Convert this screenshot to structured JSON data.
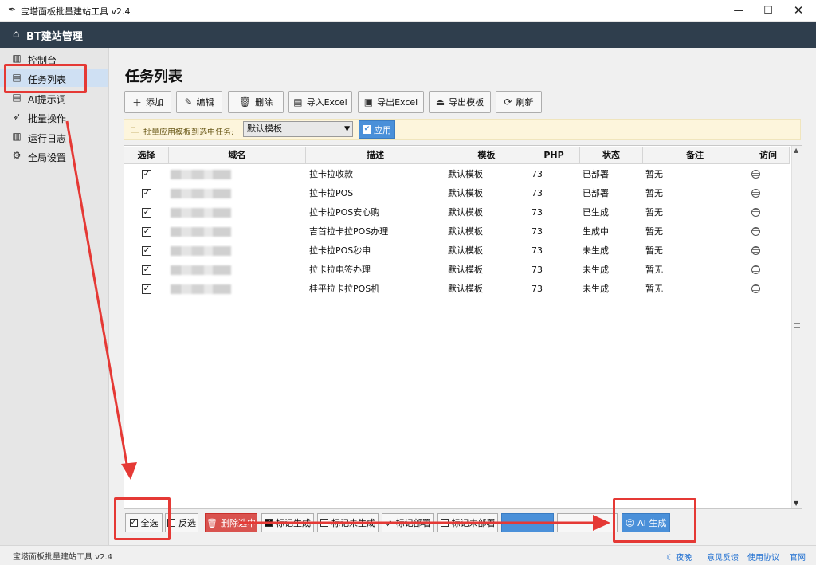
{
  "window": {
    "title": "宝塔面板批量建站工具 v2.4",
    "min": "—",
    "max": "☐",
    "close": "✕"
  },
  "header": {
    "brand": "BT建站管理"
  },
  "sidebar": {
    "items": [
      {
        "label": "控制台",
        "icon": "chart-icon",
        "glyph": "▥"
      },
      {
        "label": "任务列表",
        "icon": "clipboard-icon",
        "glyph": "▤"
      },
      {
        "label": "AI提示词",
        "icon": "document-icon",
        "glyph": "▤"
      },
      {
        "label": "批量操作",
        "icon": "rocket-icon",
        "glyph": "➶"
      },
      {
        "label": "运行日志",
        "icon": "book-icon",
        "glyph": "▥"
      },
      {
        "label": "全局设置",
        "icon": "gear-icon",
        "glyph": "⚙"
      }
    ]
  },
  "main": {
    "title": "任务列表",
    "toolbar": {
      "add": "添加",
      "edit": "编辑",
      "delete": "删除",
      "import": "导入Excel",
      "export": "导出Excel",
      "export_template": "导出模板",
      "refresh": "刷新"
    },
    "batch": {
      "label": "批量应用模板到选中任务:",
      "selected": "默认模板",
      "apply": "应用"
    },
    "table": {
      "headers": [
        "选择",
        "域名",
        "描述",
        "模板",
        "PHP",
        "状态",
        "备注",
        "访问"
      ],
      "rows": [
        {
          "desc": "拉卡拉收款",
          "template": "默认模板",
          "php": "73",
          "status": "已部署",
          "note": "暂无"
        },
        {
          "desc": "拉卡拉POS",
          "template": "默认模板",
          "php": "73",
          "status": "已部署",
          "note": "暂无"
        },
        {
          "desc": "拉卡拉POS安心购",
          "template": "默认模板",
          "php": "73",
          "status": "已生成",
          "note": "暂无"
        },
        {
          "desc": "吉首拉卡拉POS办理",
          "template": "默认模板",
          "php": "73",
          "status": "生成中",
          "note": "暂无"
        },
        {
          "desc": "拉卡拉POS秒申",
          "template": "默认模板",
          "php": "73",
          "status": "未生成",
          "note": "暂无"
        },
        {
          "desc": "拉卡拉电签办理",
          "template": "默认模板",
          "php": "73",
          "status": "未生成",
          "note": "暂无"
        },
        {
          "desc": "桂平拉卡拉POS机",
          "template": "默认模板",
          "php": "73",
          "status": "未生成",
          "note": "暂无"
        }
      ]
    },
    "bottom": {
      "select_all": "全选",
      "invert": "反选",
      "delete_selected": "删除选中",
      "mark_generated": "标记生成",
      "mark_not_generated": "标记未生成",
      "mark_deployed": "标记部署",
      "mark_not_deployed": "标记未部署",
      "ai_generate": "AI 生成"
    }
  },
  "status": {
    "text": "宝塔面板批量建站工具 v2.4",
    "links": {
      "night": "夜晚",
      "feedback": "意见反馈",
      "terms": "使用协议",
      "website": "官网"
    }
  },
  "colors": {
    "header": "#2f3e4d",
    "accent": "#4a90d9",
    "danger": "#d9534f",
    "annotation": "#e53935"
  }
}
